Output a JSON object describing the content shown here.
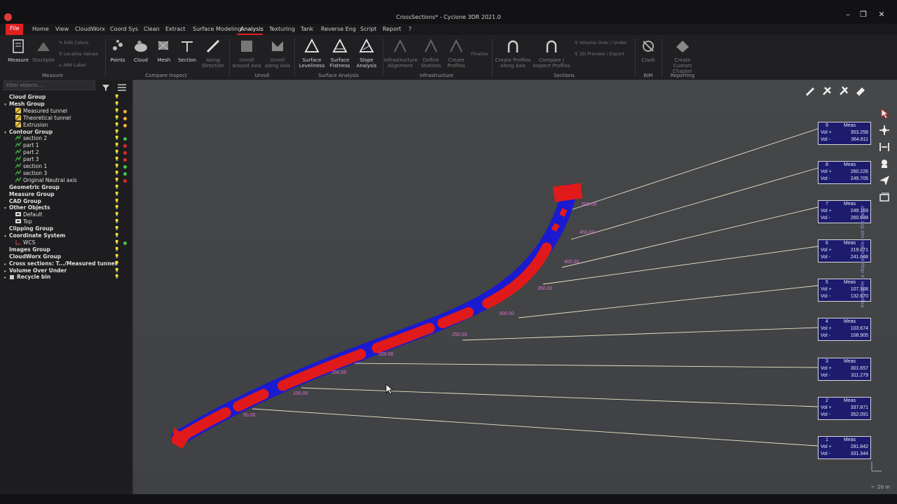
{
  "window": {
    "title": "CrossSections* - Cyclone 3DR 2021.0",
    "controls": [
      "–",
      "❐",
      "✕"
    ]
  },
  "menu": {
    "items": [
      "File",
      "Home",
      "View",
      "CloudWorx",
      "Coord Sys",
      "Clean",
      "Extract",
      "Surface Modeling",
      "Analysis",
      "Texturing",
      "Tank",
      "Reverse Eng",
      "Script",
      "Report",
      "?"
    ],
    "active": "Analysis"
  },
  "ribbon": {
    "measure": {
      "label": "Measure",
      "stockpile": "Stockpile",
      "edit_colors": "Edit Colors",
      "localize_values": "Localize Values",
      "add_label": "Add Label",
      "group": "Measure"
    },
    "compare": {
      "points": "Points",
      "cloud": "Cloud",
      "mesh": "Mesh",
      "section": "Section",
      "along_direction": "Along Direction",
      "group": "Compare Inspect"
    },
    "unroll": {
      "around_axis": "Unroll around Axis",
      "along_axis": "Unroll along Axis",
      "group": "Unroll"
    },
    "surface": {
      "leveliness": "Surface Leveliness",
      "flatness": "Surface Flatness",
      "slope": "Slope Analysis",
      "group": "Surface Analysis"
    },
    "infra": {
      "alignment": "Infrastructure Alignment",
      "stations": "Define Stations",
      "profiles": "Create Profiles",
      "finalize": "Finalize",
      "group": "Infrastructure"
    },
    "sections": {
      "create_profiles": "Create Profiles along Axis",
      "compare_profiles": "Compare / Inspect Profiles",
      "volume": "Volume Over / Under",
      "preview": "2D Preview / Export",
      "group": "Sections"
    },
    "bim": {
      "clash": "Clash",
      "group": "BIM"
    },
    "reporting": {
      "chapter": "Create Custom Chapter",
      "group": "Reporting"
    }
  },
  "tree": {
    "filter_placeholder": "Filter objects...",
    "items": [
      {
        "label": "Cloud Group",
        "bold": true,
        "level": 0,
        "arrow": "",
        "color": ""
      },
      {
        "label": "Mesh Group",
        "bold": true,
        "level": 0,
        "arrow": "▾",
        "color": ""
      },
      {
        "label": "Measured tunnel",
        "bold": false,
        "level": 1,
        "arrow": "",
        "color": "#f2b233",
        "icon": "mesh"
      },
      {
        "label": "Theoretical tunnel",
        "bold": false,
        "level": 1,
        "arrow": "",
        "color": "#f2b233",
        "icon": "mesh"
      },
      {
        "label": "Extrusion",
        "bold": false,
        "level": 1,
        "arrow": "",
        "color": "#f2b233",
        "icon": "mesh"
      },
      {
        "label": "Contour Group",
        "bold": true,
        "level": 0,
        "arrow": "▾",
        "color": ""
      },
      {
        "label": "section 2",
        "bold": false,
        "level": 1,
        "arrow": "",
        "color": "#43c44a",
        "icon": "contour"
      },
      {
        "label": "part 1",
        "bold": false,
        "level": 1,
        "arrow": "",
        "color": "#e02a2a",
        "icon": "contour"
      },
      {
        "label": "part 2",
        "bold": false,
        "level": 1,
        "arrow": "",
        "color": "#e02a2a",
        "icon": "contour"
      },
      {
        "label": "part 3",
        "bold": false,
        "level": 1,
        "arrow": "",
        "color": "#e02a2a",
        "icon": "contour"
      },
      {
        "label": "section 1",
        "bold": false,
        "level": 1,
        "arrow": "",
        "color": "#43c44a",
        "icon": "contour"
      },
      {
        "label": "section 3",
        "bold": false,
        "level": 1,
        "arrow": "",
        "color": "#43c44a",
        "icon": "contour"
      },
      {
        "label": "Original Neutral axis",
        "bold": false,
        "level": 1,
        "arrow": "",
        "color": "#e02a2a",
        "icon": "contour"
      },
      {
        "label": "Geometric Group",
        "bold": true,
        "level": 0,
        "arrow": "",
        "color": ""
      },
      {
        "label": "Measure Group",
        "bold": true,
        "level": 0,
        "arrow": "",
        "color": ""
      },
      {
        "label": "CAD Group",
        "bold": true,
        "level": 0,
        "arrow": "",
        "color": ""
      },
      {
        "label": "Other Objects",
        "bold": true,
        "level": 0,
        "arrow": "▾",
        "color": ""
      },
      {
        "label": "Default",
        "bold": false,
        "level": 1,
        "arrow": "",
        "color": "",
        "icon": "view"
      },
      {
        "label": "Top",
        "bold": false,
        "level": 1,
        "arrow": "",
        "color": "",
        "icon": "view"
      },
      {
        "label": "Clipping Group",
        "bold": true,
        "level": 0,
        "arrow": "",
        "color": ""
      },
      {
        "label": "Coordinate System",
        "bold": true,
        "level": 0,
        "arrow": "▾",
        "color": ""
      },
      {
        "label": "WCS",
        "bold": false,
        "level": 1,
        "arrow": "",
        "color": "#43c44a",
        "icon": "axes"
      },
      {
        "label": "Images Group",
        "bold": true,
        "level": 0,
        "arrow": "",
        "color": ""
      },
      {
        "label": "CloudWorx Group",
        "bold": true,
        "level": 0,
        "arrow": "",
        "color": ""
      },
      {
        "label": "Cross sections: T.../Measured tunnel",
        "bold": true,
        "level": 0,
        "arrow": "▸",
        "color": ""
      },
      {
        "label": "Volume Over Under",
        "bold": true,
        "level": 0,
        "arrow": "▸",
        "color": ""
      },
      {
        "label": "Recycle bin",
        "bold": true,
        "level": 0,
        "arrow": "▸",
        "color": "",
        "icon": "bin"
      }
    ]
  },
  "viewport": {
    "stations": [
      "500.00",
      "450.00",
      "400.00",
      "350.00",
      "300.00",
      "250.00",
      "200.00",
      "150.00",
      "100.00",
      "50.00"
    ],
    "measures": [
      {
        "num": "9",
        "header": "Meas",
        "vol_plus": "353.258",
        "vol_minus": "364.811"
      },
      {
        "num": "8",
        "header": "Meas",
        "vol_plus": "260.226",
        "vol_minus": "249.705"
      },
      {
        "num": "7",
        "header": "Meas",
        "vol_plus": "249.169",
        "vol_minus": "260.698"
      },
      {
        "num": "6",
        "header": "Meas",
        "vol_plus": "219.071",
        "vol_minus": "241.668"
      },
      {
        "num": "5",
        "header": "Meas",
        "vol_plus": "107.368",
        "vol_minus": "132.670"
      },
      {
        "num": "4",
        "header": "Meas",
        "vol_plus": "103.674",
        "vol_minus": "108.905"
      },
      {
        "num": "3",
        "header": "Meas",
        "vol_plus": "301.657",
        "vol_minus": "311.279"
      },
      {
        "num": "2",
        "header": "Meas",
        "vol_plus": "337.871",
        "vol_minus": "352.091"
      },
      {
        "num": "1",
        "header": "Meas",
        "vol_plus": "281.842",
        "vol_minus": "331.344"
      }
    ],
    "vol_plus_label": "Vol +",
    "vol_minus_label": "Vol -",
    "side_text": "Impossible to display scale: not the same",
    "scale": "⊢ 20 m"
  }
}
